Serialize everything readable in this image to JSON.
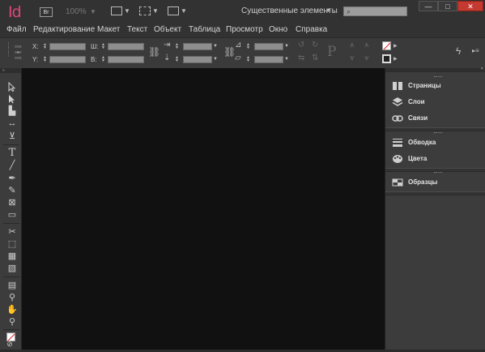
{
  "app": {
    "logo": "Id",
    "bridge": "Br",
    "zoom": "100%",
    "workspace": "Существенные элементы",
    "search_placeholder": ""
  },
  "window_controls": {
    "minimize": "—",
    "maximize": "□",
    "close": "✕"
  },
  "menu": [
    "Файл",
    "Редактирование",
    "Макет",
    "Текст",
    "Объект",
    "Таблица",
    "Просмотр",
    "Окно",
    "Справка"
  ],
  "control_panel": {
    "x_label": "X:",
    "y_label": "Y:",
    "w_label": "Ш:",
    "h_label": "В:"
  },
  "panels": {
    "group1": [
      {
        "label": "Страницы",
        "icon": "pages-icon"
      },
      {
        "label": "Слои",
        "icon": "layers-icon"
      },
      {
        "label": "Связи",
        "icon": "links-icon"
      }
    ],
    "group2": [
      {
        "label": "Обводка",
        "icon": "stroke-icon"
      },
      {
        "label": "Цвета",
        "icon": "color-palette-icon"
      }
    ],
    "group3": [
      {
        "label": "Образцы",
        "icon": "swatches-icon"
      }
    ]
  },
  "colors": {
    "logo": "#e0457c",
    "close_button": "#c43a31",
    "canvas": "#111111"
  }
}
